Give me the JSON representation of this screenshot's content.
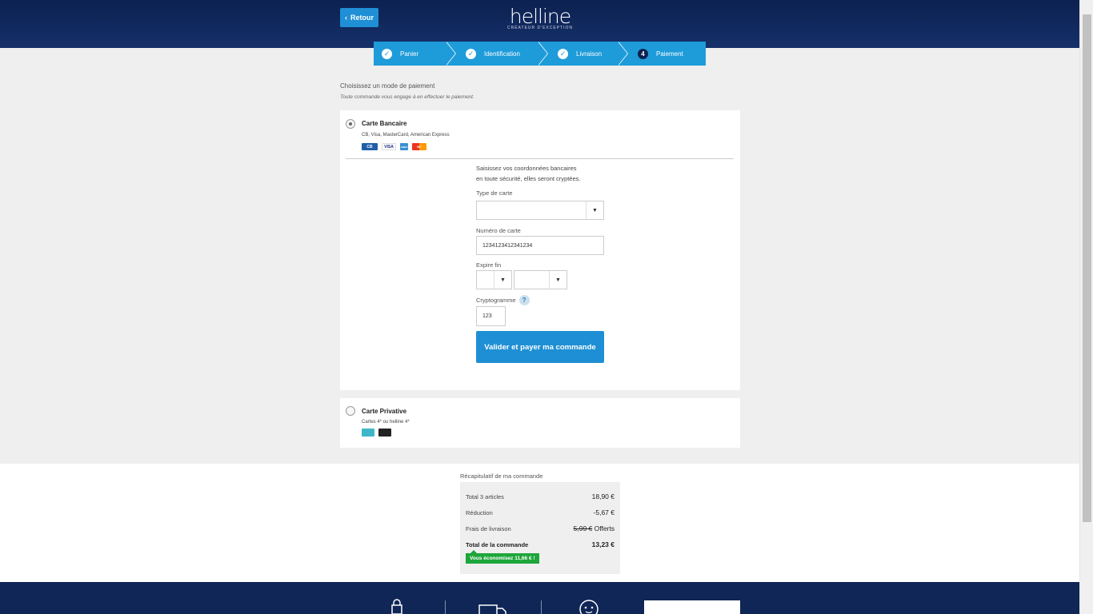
{
  "header": {
    "back_label": "Retour",
    "logo_text": "helline",
    "logo_tagline": "CRÉATEUR D'EXCEPTION"
  },
  "steps": [
    {
      "label": "Panier",
      "state": "done"
    },
    {
      "label": "Identification",
      "state": "done"
    },
    {
      "label": "Livraison",
      "state": "done"
    },
    {
      "label": "Paiement",
      "state": "current",
      "number": "4"
    }
  ],
  "intro": {
    "title": "Choisissez un mode de paiement",
    "subtitle": "Toute commande vous engage à en effectuer le paiement."
  },
  "card_option": {
    "title": "Carte Bancaire",
    "description": "CB, Visa, MasterCard, American Express",
    "selected": true,
    "logos": [
      "CB",
      "VISA",
      "AMEX",
      "MC"
    ],
    "form_intro_1": "Saisissez vos coordonnées bancaires",
    "form_intro_2": "en toute sécurité, elles seront cryptées.",
    "card_type_label": "Type de carte",
    "card_type_value": "",
    "card_number_label": "Numéro de carte",
    "card_number_value": "1234123412341234",
    "expiry_label": "Expire fin",
    "expiry_month": "",
    "expiry_year": "",
    "cvv_label": "Cryptogramme",
    "help_glyph": "?",
    "cvv_value": "123",
    "submit_label": "Valider et payer ma commande"
  },
  "private_option": {
    "title": "Carte Privative",
    "description": "Cartes 4* ou helline 4*",
    "selected": false
  },
  "summary": {
    "title": "Récapitulatif de ma commande",
    "rows": [
      {
        "label": "Total 3 articles",
        "value": "18,90 €"
      },
      {
        "label": "Réduction",
        "value": "-5,67 €"
      }
    ],
    "shipping_label": "Frais de livraison",
    "shipping_old": "5,99 €",
    "shipping_new": "Offerts",
    "total_label": "Total de la commande",
    "total_value": "13,23 €",
    "savings": "Vous économisez 11,66 € !"
  },
  "colors": {
    "header": "#0c2150",
    "accent": "#1e9bd9",
    "savings": "#1ea63a"
  }
}
